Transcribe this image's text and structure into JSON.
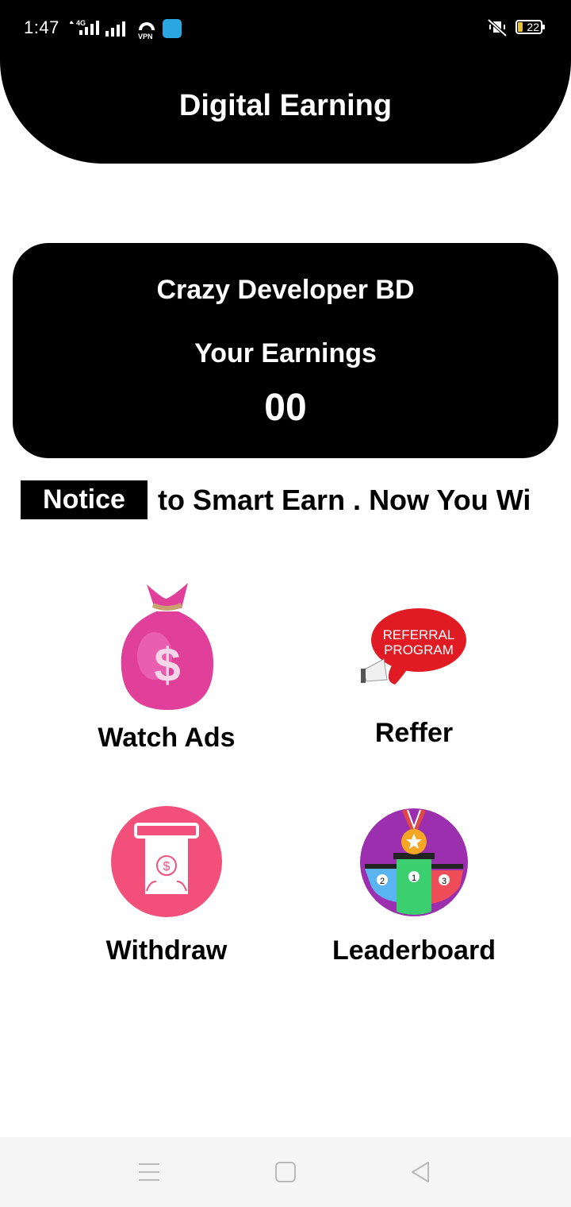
{
  "status_bar": {
    "time": "1:47",
    "network_label": "4G",
    "battery_level": "22"
  },
  "header": {
    "title": "Digital Earning"
  },
  "earnings_card": {
    "name": "Crazy Developer BD",
    "label": "Your Earnings",
    "value": "00"
  },
  "notice": {
    "badge": "Notice",
    "text": "to Smart Earn . Now You Wi"
  },
  "menu": {
    "watch_ads": "Watch Ads",
    "reffer": "Reffer",
    "withdraw": "Withdraw",
    "leaderboard": "Leaderboard",
    "referral_banner_line1": "REFERRAL",
    "referral_banner_line2": "PROGRAM"
  },
  "colors": {
    "header_bg": "#000000",
    "card_bg": "#000000",
    "money_bag": "#e0409a",
    "withdraw_circle": "#f2507a",
    "referral_bubble": "#e01b24",
    "leaderboard_circle": "#9b2fae"
  },
  "icons": [
    "money-bag-icon",
    "referral-megaphone-icon",
    "atm-withdraw-icon",
    "podium-medal-icon"
  ]
}
